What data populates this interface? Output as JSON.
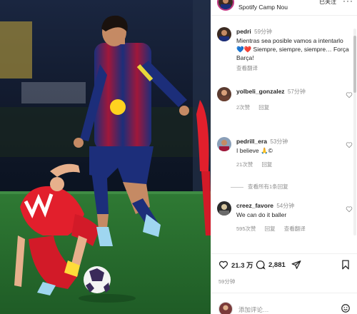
{
  "header": {
    "location": "Spotify Camp Nou",
    "follow_label": "已关注",
    "more_label": "···"
  },
  "caption": {
    "username": "pedri",
    "time": "59分钟",
    "text": "Mientras sea posible vamos a intentarlo 💙❤️ Siempre, siempre, siempre… Força Barça!",
    "translate": "查看翻译"
  },
  "comments": [
    {
      "username": "yolbeli_gonzalez",
      "time": "57分钟",
      "text": "",
      "likes": "2次赞",
      "reply": "回复",
      "translate": ""
    },
    {
      "username": "pedrill_era",
      "time": "53分钟",
      "text": "I believe 🙏©",
      "likes": "21次赞",
      "reply": "回复",
      "translate": ""
    },
    {
      "username": "creez_favore",
      "time": "54分钟",
      "text": "We can do it baller",
      "likes": "595次赞",
      "reply": "回复",
      "translate": "查看翻译"
    }
  ],
  "replies_label": "查看所有1条回复",
  "actions": {
    "likes": "21.3 万",
    "comments": "2,881"
  },
  "date": "59分钟",
  "add_comment_placeholder": "添加评论…"
}
